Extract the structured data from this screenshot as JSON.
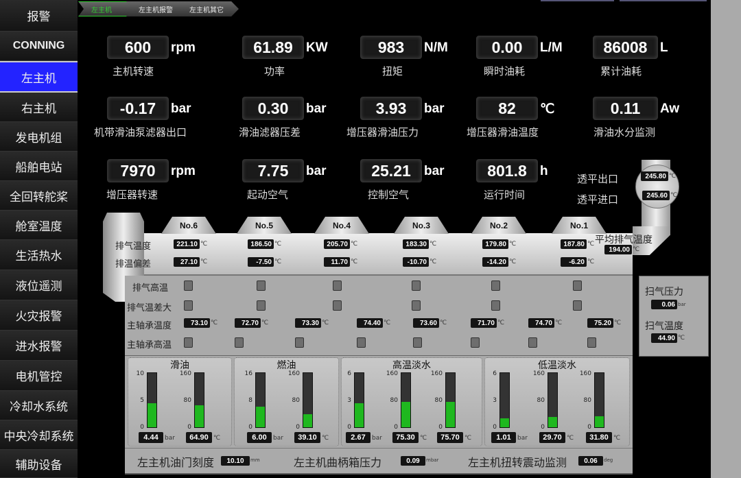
{
  "sidebar": {
    "items": [
      "报警",
      "CONNING",
      "左主机",
      "右主机",
      "发电机组",
      "船舶电站",
      "全回转舵桨",
      "舱室温度",
      "生活热水",
      "液位遥测",
      "火灾报警",
      "进水报警",
      "电机管控",
      "冷却水系统",
      "中央冷却系统",
      "辅助设备"
    ],
    "active": "左主机"
  },
  "breadcrumb": [
    "左主机",
    "左主机报警",
    "左主机其它"
  ],
  "readouts": [
    {
      "value": "600",
      "unit": "rpm",
      "label": "主机转速"
    },
    {
      "value": "61.89",
      "unit": "KW",
      "label": "功率"
    },
    {
      "value": "983",
      "unit": "N/M",
      "label": "扭矩"
    },
    {
      "value": "0.00",
      "unit": "L/M",
      "label": "瞬时油耗"
    },
    {
      "value": "86008",
      "unit": "L",
      "label": "累计油耗"
    },
    {
      "value": "-0.17",
      "unit": "bar",
      "label": "机带滑油泵滤器出口"
    },
    {
      "value": "0.30",
      "unit": "bar",
      "label": "滑油滤器压差"
    },
    {
      "value": "3.93",
      "unit": "bar",
      "label": "增压器滑油压力"
    },
    {
      "value": "82",
      "unit": "℃",
      "label": "增压器滑油温度"
    },
    {
      "value": "0.11",
      "unit": "Aw",
      "label": "滑油水分监测"
    },
    {
      "value": "7970",
      "unit": "rpm",
      "label": "增压器转速"
    },
    {
      "value": "7.75",
      "unit": "bar",
      "label": "起动空气"
    },
    {
      "value": "25.21",
      "unit": "bar",
      "label": "控制空气"
    },
    {
      "value": "801.8",
      "unit": "h",
      "label": "运行时间"
    }
  ],
  "turbo": {
    "outlet_label": "透平出口",
    "outlet": "245.80",
    "inlet_label": "透平进口",
    "inlet": "245.60",
    "unit": "℃"
  },
  "cylinders": {
    "names": [
      "No.6",
      "No.5",
      "No.4",
      "No.3",
      "No.2",
      "No.1"
    ],
    "exhaust_label": "排气温度",
    "exhaust": [
      "221.10",
      "186.50",
      "205.70",
      "183.30",
      "179.80",
      "187.80"
    ],
    "deviation_label": "排温偏差",
    "deviation": [
      "27.10",
      "-7.50",
      "11.70",
      "-10.70",
      "-14.20",
      "-6.20"
    ],
    "avg_label": "平均排气温度",
    "avg": "194.00",
    "unit": "℃",
    "high_temp_label": "排气高温",
    "high_diff_label": "排气温差大"
  },
  "bearings": {
    "temp_label": "主轴承温度",
    "temps": [
      "73.10",
      "72.70",
      "73.30",
      "74.40",
      "73.60",
      "71.70",
      "74.70",
      "75.20"
    ],
    "alarm_label": "主轴承高温",
    "unit": "℃"
  },
  "scavenge": {
    "pressure_label": "扫气压力",
    "pressure": "0.06",
    "pressure_unit": "bar",
    "temp_label": "扫气温度",
    "temp": "44.90",
    "temp_unit": "℃"
  },
  "gauges": [
    {
      "title": "滑油",
      "bars": [
        {
          "max": "10",
          "mid": "5",
          "min": "0",
          "value": "4.44",
          "unit": "bar",
          "fraction": 0.444
        },
        {
          "max": "160",
          "mid": "80",
          "min": "0",
          "value": "64.90",
          "unit": "℃",
          "fraction": 0.406
        }
      ]
    },
    {
      "title": "燃油",
      "bars": [
        {
          "max": "16",
          "mid": "8",
          "min": "0",
          "value": "6.00",
          "unit": "bar",
          "fraction": 0.375
        },
        {
          "max": "160",
          "mid": "80",
          "min": "0",
          "value": "39.10",
          "unit": "℃",
          "fraction": 0.244
        }
      ]
    },
    {
      "title": "高温淡水",
      "bars": [
        {
          "max": "6",
          "mid": "3",
          "min": "0",
          "value": "2.67",
          "unit": "bar",
          "fraction": 0.445
        },
        {
          "max": "160",
          "mid": "80",
          "min": "0",
          "value": "75.30",
          "unit": "℃",
          "fraction": 0.471
        },
        {
          "max": "160",
          "mid": "80",
          "min": "0",
          "value": "75.70",
          "unit": "℃",
          "fraction": 0.473
        }
      ]
    },
    {
      "title": "低温淡水",
      "bars": [
        {
          "max": "6",
          "mid": "3",
          "min": "0",
          "value": "1.01",
          "unit": "bar",
          "fraction": 0.168
        },
        {
          "max": "160",
          "mid": "80",
          "min": "0",
          "value": "29.70",
          "unit": "℃",
          "fraction": 0.186
        },
        {
          "max": "160",
          "mid": "80",
          "min": "0",
          "value": "31.80",
          "unit": "℃",
          "fraction": 0.199
        }
      ]
    }
  ],
  "bottom": [
    {
      "label": "左主机油门刻度",
      "value": "10.10",
      "unit": "mm"
    },
    {
      "label": "左主机曲柄箱压力",
      "value": "0.09",
      "unit": "mbar"
    },
    {
      "label": "左主机扭转震动监测",
      "value": "0.06",
      "unit": "deg"
    }
  ],
  "colors": {
    "active_nav": "#2323ff",
    "gauge_fill": "#1fb81f",
    "panel": "#b0b0b0"
  }
}
